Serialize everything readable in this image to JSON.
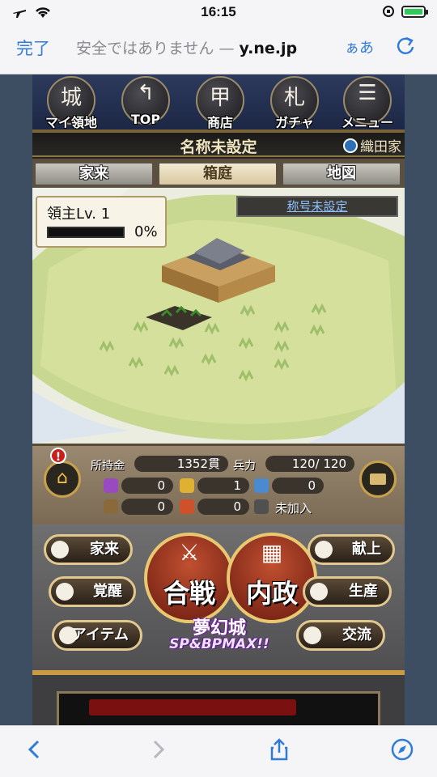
{
  "status": {
    "time": "16:15",
    "airplane_icon": "airplane-icon",
    "wifi_icon": "wifi-icon"
  },
  "browser": {
    "done_label": "完了",
    "url_prefix": "安全ではありません — ",
    "url_host": "y.ne.jp",
    "text_size_label": "ぁあ"
  },
  "game": {
    "nav": [
      {
        "label": "マイ領地",
        "glyph": "城"
      },
      {
        "label": "TOP",
        "glyph": "↰"
      },
      {
        "label": "商店",
        "glyph": "甲"
      },
      {
        "label": "ガチャ",
        "glyph": "札"
      },
      {
        "label": "メニュー",
        "glyph": "☰"
      }
    ],
    "castle_name": "名称未設定",
    "clan": "織田家",
    "tabs": [
      {
        "label": "家来"
      },
      {
        "label": "箱庭"
      },
      {
        "label": "地図"
      }
    ],
    "lord_level": "領主Lv. 1",
    "lord_progress": "0%",
    "lord_progress_value": 0,
    "title_link": "称号未設定",
    "resources": {
      "gold_label": "所持金",
      "gold_value": "1352貫",
      "troops_label": "兵力",
      "troops_value": "120/  120",
      "r1": "0",
      "r2": "1",
      "r3": "0",
      "r4": "0",
      "r5": "0",
      "guild": "未加入",
      "alert": "!"
    },
    "actions": {
      "retainer": "家来",
      "awaken": "覚醒",
      "item": "アイテム",
      "battle": "合戦",
      "domestic": "内政",
      "offering": "献上",
      "production": "生産",
      "exchange": "交流",
      "event_title": "夢幻城",
      "event_sub": "SP&BPMAX!!"
    }
  }
}
